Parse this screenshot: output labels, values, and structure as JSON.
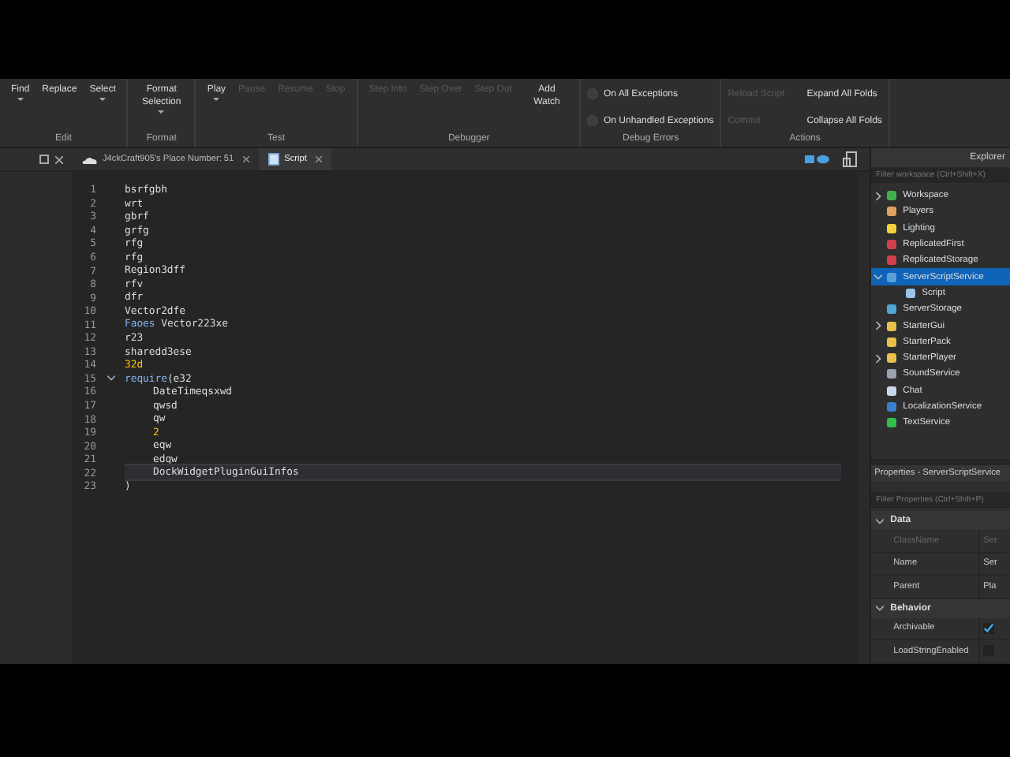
{
  "ribbon": {
    "groups": [
      {
        "label": "Edit",
        "buttons": [
          {
            "label": "Find",
            "disabled": false,
            "dropdown": true,
            "kind": "icon"
          },
          {
            "label": "Replace",
            "disabled": false,
            "dropdown": false,
            "kind": "icon"
          },
          {
            "label": "Select",
            "disabled": false,
            "dropdown": true,
            "kind": "icon"
          }
        ]
      },
      {
        "label": "Format",
        "buttons": [
          {
            "label": "Format Selection",
            "disabled": false,
            "dropdown": true,
            "kind": "icon"
          }
        ]
      },
      {
        "label": "Test",
        "buttons": [
          {
            "label": "Play",
            "disabled": false,
            "dropdown": true,
            "kind": "icon"
          },
          {
            "label": "Pause",
            "disabled": true,
            "dropdown": false,
            "kind": "icon"
          },
          {
            "label": "Resume",
            "disabled": true,
            "dropdown": false,
            "kind": "icon"
          },
          {
            "label": "Stop",
            "disabled": true,
            "dropdown": false,
            "kind": "icon"
          }
        ]
      },
      {
        "label": "Debugger",
        "buttons": [
          {
            "label": "Step Into",
            "disabled": true,
            "dropdown": false,
            "kind": "icon"
          },
          {
            "label": "Step Over",
            "disabled": true,
            "dropdown": false,
            "kind": "icon"
          },
          {
            "label": "Step Out",
            "disabled": true,
            "dropdown": false,
            "kind": "icon"
          },
          {
            "label": "Add Watch",
            "disabled": false,
            "dropdown": false,
            "kind": "icon"
          }
        ]
      },
      {
        "label": "Debug Errors",
        "buttons": [
          {
            "label": "On All Exceptions",
            "kind": "radio",
            "selected": false
          },
          {
            "label": "On Unhandled Exceptions",
            "kind": "radio",
            "selected": false
          }
        ]
      },
      {
        "label": "Actions",
        "buttons": [
          {
            "label": "Reload Script",
            "disabled": true,
            "kind": "text"
          },
          {
            "label": "Commit",
            "disabled": true,
            "kind": "text"
          },
          {
            "label": "Expand All Folds",
            "disabled": false,
            "kind": "text"
          },
          {
            "label": "Collapse All Folds",
            "disabled": false,
            "kind": "text"
          }
        ]
      }
    ]
  },
  "tabs": [
    {
      "label": "J4ckCraft905's Place Number: 51",
      "selected": false
    },
    {
      "label": "Script",
      "selected": true
    }
  ],
  "editor": {
    "lines": [
      {
        "number": "1",
        "current": false,
        "indent": false,
        "tokens": [
          {
            "text": "bsrfgbh",
            "kind": "plain"
          }
        ]
      },
      {
        "number": "2",
        "current": false,
        "indent": false,
        "tokens": [
          {
            "text": "wrt",
            "kind": "plain"
          }
        ]
      },
      {
        "number": "3",
        "current": false,
        "indent": false,
        "tokens": [
          {
            "text": "gbrf",
            "kind": "plain"
          }
        ]
      },
      {
        "number": "4",
        "current": false,
        "indent": false,
        "tokens": [
          {
            "text": "grfg",
            "kind": "plain"
          }
        ]
      },
      {
        "number": "5",
        "current": false,
        "indent": false,
        "tokens": [
          {
            "text": "rfg",
            "kind": "plain"
          }
        ]
      },
      {
        "number": "6",
        "current": false,
        "indent": false,
        "tokens": [
          {
            "text": "rfg",
            "kind": "plain"
          }
        ]
      },
      {
        "number": "7",
        "current": false,
        "indent": false,
        "tokens": [
          {
            "text": "Region3dff",
            "kind": "plain"
          }
        ]
      },
      {
        "number": "8",
        "current": false,
        "indent": false,
        "tokens": [
          {
            "text": "rfv",
            "kind": "plain"
          }
        ]
      },
      {
        "number": "9",
        "current": false,
        "indent": false,
        "tokens": [
          {
            "text": "dfr",
            "kind": "plain"
          }
        ]
      },
      {
        "number": "10",
        "current": false,
        "indent": false,
        "tokens": [
          {
            "text": "Vector2dfe",
            "kind": "plain"
          }
        ]
      },
      {
        "number": "11",
        "current": false,
        "indent": false,
        "tokens": [
          {
            "text": "Faoes",
            "kind": "keyword"
          },
          {
            "text": "Vector223xe",
            "kind": "plain"
          }
        ]
      },
      {
        "number": "12",
        "current": false,
        "indent": false,
        "tokens": [
          {
            "text": "r23",
            "kind": "plain"
          }
        ]
      },
      {
        "number": "13",
        "current": false,
        "indent": false,
        "tokens": [
          {
            "text": "sharedd3ese",
            "kind": "plain"
          }
        ]
      },
      {
        "number": "14",
        "current": false,
        "indent": false,
        "tokens": [
          {
            "text": "32d",
            "kind": "number"
          }
        ]
      },
      {
        "number": "15",
        "fold": true,
        "current": false,
        "indent": false,
        "tokens": [
          {
            "text": "require",
            "kind": "keyword"
          },
          {
            "text": "(e32",
            "kind": "plain"
          }
        ]
      },
      {
        "number": "16",
        "current": false,
        "indent": true,
        "tokens": [
          {
            "text": "DateTimeqsxwd",
            "kind": "plain"
          }
        ]
      },
      {
        "number": "17",
        "current": false,
        "indent": true,
        "tokens": [
          {
            "text": "qwsd",
            "kind": "plain"
          }
        ]
      },
      {
        "number": "18",
        "current": false,
        "indent": true,
        "tokens": [
          {
            "text": "qw",
            "kind": "plain"
          }
        ]
      },
      {
        "number": "19",
        "current": false,
        "indent": true,
        "tokens": [
          {
            "text": "2",
            "kind": "number"
          }
        ]
      },
      {
        "number": "20",
        "current": false,
        "indent": true,
        "tokens": [
          {
            "text": "eqw",
            "kind": "plain"
          }
        ]
      },
      {
        "number": "21",
        "current": false,
        "indent": true,
        "tokens": [
          {
            "text": "edqw",
            "kind": "plain"
          }
        ]
      },
      {
        "number": "22",
        "current": true,
        "indent": true,
        "tokens": [
          {
            "text": "DockWidgetPluginGuiInfos",
            "kind": "plain"
          }
        ]
      },
      {
        "number": "23",
        "current": false,
        "indent": false,
        "tokens": [
          {
            "text": ")",
            "kind": "plain"
          }
        ]
      }
    ]
  },
  "explorer": {
    "title": "Explorer",
    "filter_placeholder": "Filter workspace (Ctrl+Shift+X)",
    "items": [
      {
        "name": "Workspace",
        "color": "#3fb24a",
        "expanded": false,
        "selected": false
      },
      {
        "name": "Players",
        "color": "#e0a060",
        "selected": false
      },
      {
        "name": "Lighting",
        "color": "#f2d13c",
        "selected": false
      },
      {
        "name": "ReplicatedFirst",
        "color": "#d0404a",
        "selected": false
      },
      {
        "name": "ReplicatedStorage",
        "color": "#d0404a",
        "selected": false
      },
      {
        "name": "ServerScriptService",
        "color": "#5aa0d8",
        "expanded": true,
        "selected": true,
        "children": [
          {
            "name": "Script",
            "color": "#9cc4ea",
            "selected": false
          }
        ]
      },
      {
        "name": "ServerStorage",
        "color": "#4fa6d8",
        "selected": false
      },
      {
        "name": "StarterGui",
        "color": "#e8c04a",
        "expanded": false,
        "selected": false
      },
      {
        "name": "StarterPack",
        "color": "#e8c04a",
        "selected": false
      },
      {
        "name": "StarterPlayer",
        "color": "#e8c04a",
        "expanded": false,
        "selected": false
      },
      {
        "name": "SoundService",
        "color": "#9aa4b0",
        "selected": false
      },
      {
        "name": "Chat",
        "color": "#c8d8ea",
        "selected": false
      },
      {
        "name": "LocalizationService",
        "color": "#3a7ed0",
        "selected": false
      },
      {
        "name": "TextService",
        "color": "#2fbf4a",
        "selected": false
      }
    ]
  },
  "properties": {
    "title": "Properties - ServerScriptService",
    "filter_placeholder": "Filter Properties (Ctrl+Shift+P)",
    "sections": [
      {
        "name": "Data",
        "expanded": true,
        "rows": [
          {
            "name": "ClassName",
            "kind": "text",
            "value": "Ser",
            "disabled": true
          },
          {
            "name": "Name",
            "kind": "text",
            "value": "Ser",
            "disabled": false
          },
          {
            "name": "Parent",
            "kind": "text",
            "value": "Pla",
            "disabled": false
          }
        ]
      },
      {
        "name": "Behavior",
        "expanded": true,
        "rows": [
          {
            "name": "Archivable",
            "kind": "checkbox",
            "checked": true,
            "disabled": false
          },
          {
            "name": "LoadStringEnabled",
            "kind": "checkbox",
            "checked": false,
            "disabled": false
          }
        ]
      }
    ]
  }
}
